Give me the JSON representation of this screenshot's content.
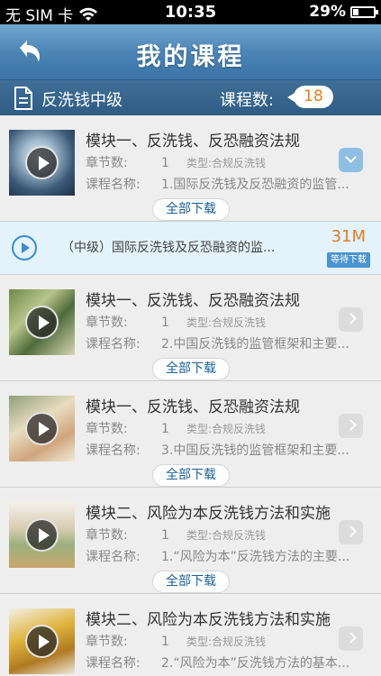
{
  "status_bar": {
    "carrier": "无 SIM 卡",
    "time": "10:35",
    "battery": "29%",
    "battery_level": 0.29
  },
  "nav": {
    "title": "我的课程"
  },
  "info": {
    "category": "反洗钱中级",
    "count_label": "课程数:",
    "count": "18"
  },
  "labels": {
    "chapters": "章节数:",
    "course_name": "课程名称:",
    "type_prefix": "类型:",
    "download_all": "全部下载"
  },
  "courses": [
    {
      "module": "模块一、反洗钱、反恐融资法规",
      "chapters": "1",
      "type": "合规反洗钱",
      "name": "1.国际反洗钱及反恐融资的监管...",
      "expanded": true
    },
    {
      "module": "模块一、反洗钱、反恐融资法规",
      "chapters": "1",
      "type": "合规反洗钱",
      "name": "2.中国反洗钱的监管框架和主要...",
      "expanded": false
    },
    {
      "module": "模块一、反洗钱、反恐融资法规",
      "chapters": "1",
      "type": "合规反洗钱",
      "name": "3.中国反洗钱的监管框架和主要...",
      "expanded": false
    },
    {
      "module": "模块二、风险为本反洗钱方法和实施",
      "chapters": "1",
      "type": "合规反洗钱",
      "name": "1.“风险为本”反洗钱方法的主要...",
      "expanded": false
    },
    {
      "module": "模块二、风险为本反洗钱方法和实施",
      "chapters": "1",
      "type": "合规反洗钱",
      "name": "2.“风险为本”反洗钱方法的基本...",
      "expanded": false
    }
  ],
  "download_item": {
    "title": "（中级）国际反洗钱及反恐融资的监...",
    "size": "31M",
    "status": "等待下载"
  },
  "colors": {
    "nav_blue": "#4b84b5",
    "accent_orange": "#e67e22",
    "link_blue": "#1a5f96"
  }
}
